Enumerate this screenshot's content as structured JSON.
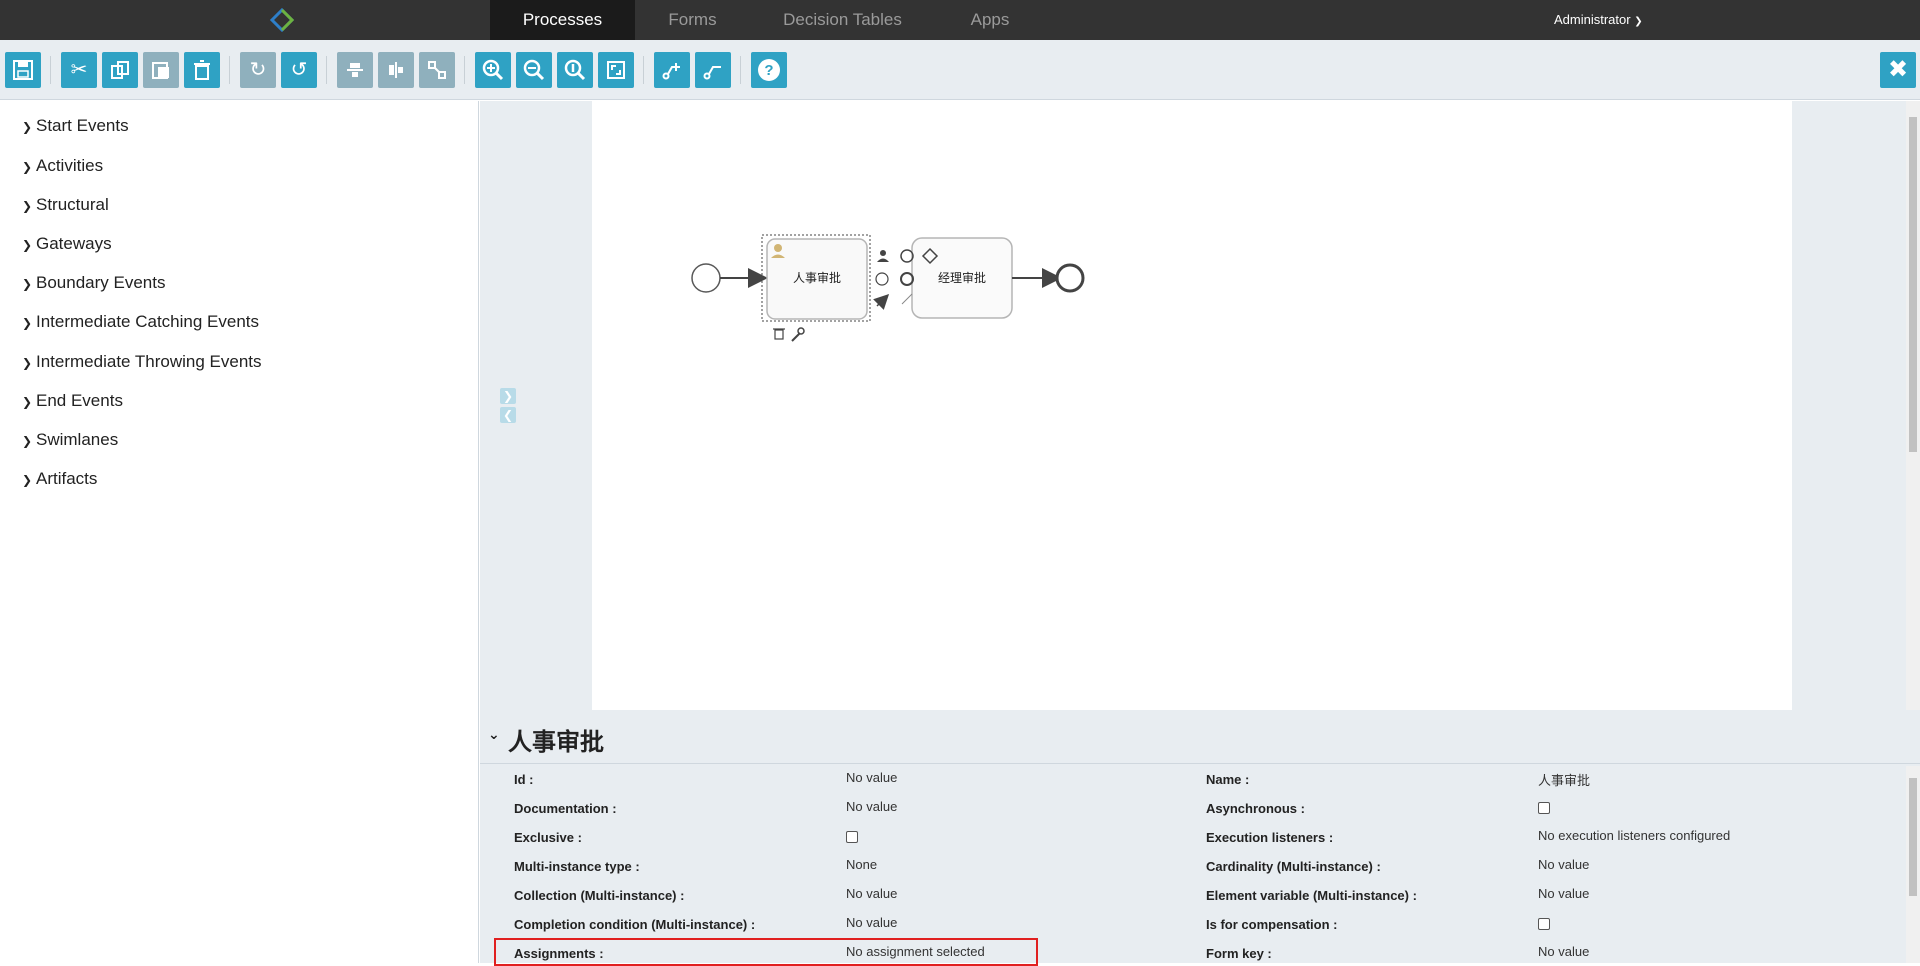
{
  "nav": {
    "tabs": [
      "Processes",
      "Forms",
      "Decision Tables",
      "Apps"
    ],
    "user": "Administrator"
  },
  "toolbar": {
    "buttons": [
      {
        "name": "save",
        "icon": "floppy-disk-icon"
      },
      {
        "name": "cut",
        "icon": "scissors-icon"
      },
      {
        "name": "copy",
        "icon": "copy-icon"
      },
      {
        "name": "paste",
        "icon": "paste-icon"
      },
      {
        "name": "delete",
        "icon": "trash-icon"
      },
      {
        "name": "redo",
        "icon": "redo-icon"
      },
      {
        "name": "undo",
        "icon": "undo-icon"
      },
      {
        "name": "align-horizontal",
        "icon": "align-horizontal-icon"
      },
      {
        "name": "align-vertical",
        "icon": "align-vertical-icon"
      },
      {
        "name": "same-size",
        "icon": "same-size-icon"
      },
      {
        "name": "zoom-in",
        "icon": "zoom-in-icon"
      },
      {
        "name": "zoom-out",
        "icon": "zoom-out-icon"
      },
      {
        "name": "zoom-actual",
        "icon": "zoom-actual-icon"
      },
      {
        "name": "zoom-fit",
        "icon": "zoom-fit-icon"
      },
      {
        "name": "add-bendpoint",
        "icon": "add-bendpoint-icon"
      },
      {
        "name": "remove-bendpoint",
        "icon": "remove-bendpoint-icon"
      },
      {
        "name": "help",
        "icon": "help-icon"
      }
    ]
  },
  "palette": {
    "items": [
      "Start Events",
      "Activities",
      "Structural",
      "Gateways",
      "Boundary Events",
      "Intermediate Catching Events",
      "Intermediate Throwing Events",
      "End Events",
      "Swimlanes",
      "Artifacts"
    ]
  },
  "diagram": {
    "task1_label": "人事审批",
    "task2_label": "经理审批"
  },
  "properties": {
    "title": "人事审批",
    "left": [
      {
        "label": "Id :",
        "value": "No value"
      },
      {
        "label": "Documentation :",
        "value": "No value"
      },
      {
        "label": "Exclusive :",
        "value": ""
      },
      {
        "label": "Multi-instance type :",
        "value": "None"
      },
      {
        "label": "Collection (Multi-instance) :",
        "value": "No value"
      },
      {
        "label": "Completion condition (Multi-instance) :",
        "value": "No value"
      },
      {
        "label": "Assignments :",
        "value": "No assignment selected"
      }
    ],
    "right": [
      {
        "label": "Name :",
        "value": "人事审批"
      },
      {
        "label": "Asynchronous :",
        "value": ""
      },
      {
        "label": "Execution listeners :",
        "value": "No execution listeners configured"
      },
      {
        "label": "Cardinality (Multi-instance) :",
        "value": "No value"
      },
      {
        "label": "Element variable (Multi-instance) :",
        "value": "No value"
      },
      {
        "label": "Is for compensation :",
        "value": ""
      },
      {
        "label": "Form key :",
        "value": "No value"
      }
    ]
  },
  "colors": {
    "topbar": "#333333",
    "toolbar_button": "#2fa2c4",
    "panel_bg": "#e8edf1"
  }
}
